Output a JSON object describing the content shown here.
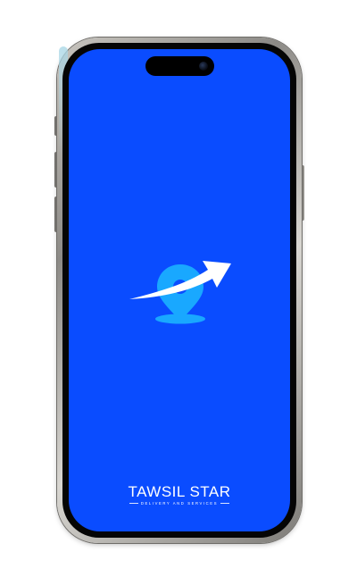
{
  "app": {
    "brand_name": "TAWSIL STAR",
    "tagline": "DELIVERY AND SERVICES"
  },
  "colors": {
    "screen_background": "#0a4cff",
    "logo_pin": "#19a8ff",
    "logo_arrow": "#ffffff",
    "text": "#ffffff"
  },
  "icons": {
    "logo": "location-pin-with-arrow-icon",
    "camera": "front-camera-icon"
  }
}
